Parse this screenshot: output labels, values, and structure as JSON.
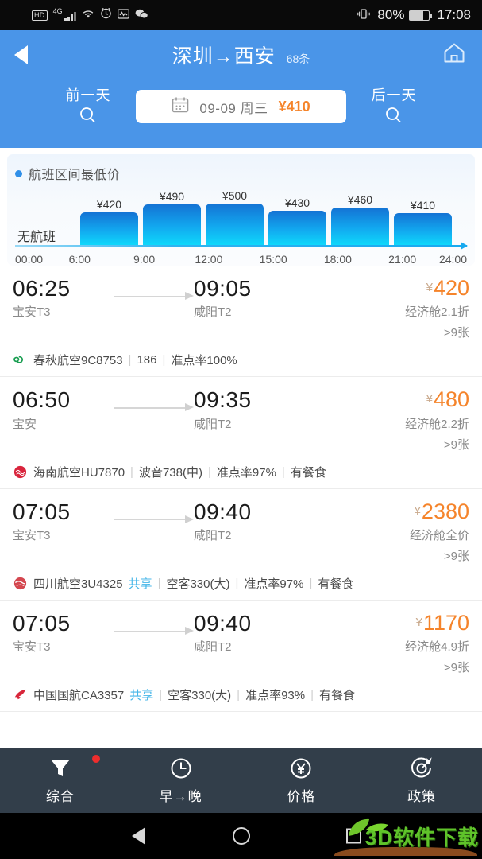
{
  "status_bar": {
    "hd_label": "HD",
    "network": "4G",
    "battery_percent": "80%",
    "time": "17:08",
    "icons": [
      "hd-icon",
      "signal-icon",
      "wifi-icon",
      "alarm-icon",
      "activity-icon",
      "wechat-icon",
      "vibrate-icon",
      "battery-icon"
    ]
  },
  "header": {
    "back_icon": "back-arrow-icon",
    "title": "深圳→西安",
    "count": "68条",
    "home_icon": "home-icon",
    "prev_day": "前一天",
    "next_day": "后一天",
    "search_icon": "magnifier-icon",
    "date": "09-09 周三",
    "date_price": "¥410",
    "calendar_icon": "calendar-icon",
    "accent_blue": "#4a95e8",
    "accent_orange": "#f5842b"
  },
  "chart_data": {
    "type": "bar",
    "title": "航班区间最低价",
    "categories": [
      "00:00-6:00",
      "6:00-9:00",
      "9:00-12:00",
      "12:00-15:00",
      "15:00-18:00",
      "18:00-21:00",
      "21:00-24:00"
    ],
    "values": [
      null,
      420,
      490,
      500,
      430,
      460,
      410
    ],
    "labels": [
      "",
      "¥420",
      "¥490",
      "¥500",
      "¥430",
      "¥460",
      "¥410"
    ],
    "empty_label": "无航班",
    "tick_labels": [
      "00:00",
      "6:00",
      "9:00",
      "12:00",
      "15:00",
      "18:00",
      "21:00",
      "24:00"
    ],
    "xlabel": "",
    "ylabel": "",
    "grid": false,
    "legend": "航班区间最低价",
    "legend_position": "top-left",
    "bar_color_top": "#1473d4",
    "bar_color_bottom": "#0fd8fb"
  },
  "flights": [
    {
      "dep_time": "06:25",
      "dep_airport": "宝安T3",
      "arr_time": "09:05",
      "arr_airport": "咸阳T2",
      "currency": "¥",
      "price": "420",
      "cabin": "经济舱2.1折",
      "seats": ">9张",
      "airline": "春秋航空9C8753",
      "share": "",
      "aircraft": "186",
      "ontime": "准点率100%",
      "meal": "",
      "logo_color": "#1a9e52",
      "logo_icon": "spring-airlines-logo"
    },
    {
      "dep_time": "06:50",
      "dep_airport": "宝安",
      "arr_time": "09:35",
      "arr_airport": "咸阳T2",
      "currency": "¥",
      "price": "480",
      "cabin": "经济舱2.2折",
      "seats": ">9张",
      "airline": "海南航空HU7870",
      "share": "",
      "aircraft": "波音738(中)",
      "ontime": "准点率97%",
      "meal": "有餐食",
      "logo_color": "#d9243c",
      "logo_icon": "hainan-airlines-logo"
    },
    {
      "dep_time": "07:05",
      "dep_airport": "宝安T3",
      "arr_time": "09:40",
      "arr_airport": "咸阳T2",
      "currency": "¥",
      "price": "2380",
      "cabin": "经济舱全价",
      "seats": ">9张",
      "airline": "四川航空3U4325",
      "share": "共享",
      "aircraft": "空客330(大)",
      "ontime": "准点率97%",
      "meal": "有餐食",
      "logo_color": "#d4474f",
      "logo_icon": "sichuan-airlines-logo"
    },
    {
      "dep_time": "07:05",
      "dep_airport": "宝安T3",
      "arr_time": "09:40",
      "arr_airport": "咸阳T2",
      "currency": "¥",
      "price": "1170",
      "cabin": "经济舱4.9折",
      "seats": ">9张",
      "airline": "中国国航CA3357",
      "share": "共享",
      "aircraft": "空客330(大)",
      "ontime": "准点率93%",
      "meal": "有餐食",
      "logo_color": "#d8263a",
      "logo_icon": "air-china-logo"
    }
  ],
  "toolbar": {
    "items": [
      {
        "label": "综合",
        "icon": "filter-icon",
        "badge": true
      },
      {
        "label": "早→晚",
        "icon": "clock-icon",
        "badge": false
      },
      {
        "label": "价格",
        "icon": "yen-circle-icon",
        "badge": false
      },
      {
        "label": "政策",
        "icon": "target-icon",
        "badge": false
      }
    ]
  },
  "navbar": {
    "back_icon": "android-back-icon",
    "home_icon": "android-home-icon",
    "recents_icon": "android-recents-icon",
    "watermark": "3D软件下载"
  }
}
